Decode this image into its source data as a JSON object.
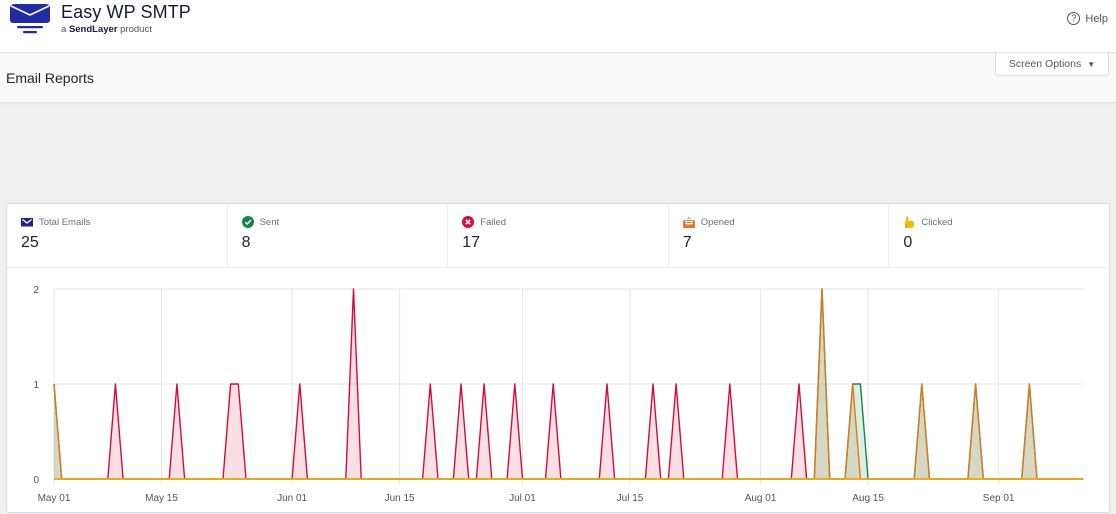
{
  "header": {
    "brand_title": "Easy WP SMTP",
    "brand_sub_prefix": "a ",
    "brand_sub_name": "SendLayer",
    "brand_sub_suffix": " product",
    "help_label": "Help",
    "logo_icon": "envelope-logo-icon",
    "help_icon": "question-circle-icon"
  },
  "subheader": {
    "page_title": "Email Reports",
    "screen_options_label": "Screen Options",
    "screen_options_icon": "caret-down-icon"
  },
  "stats": [
    {
      "key": "total",
      "label": "Total Emails",
      "value": "25",
      "icon": "envelope-icon",
      "color": "#1f1f8e"
    },
    {
      "key": "sent",
      "label": "Sent",
      "value": "8",
      "icon": "check-circle-icon",
      "color": "#128549"
    },
    {
      "key": "failed",
      "label": "Failed",
      "value": "17",
      "icon": "x-circle-icon",
      "color": "#d63638"
    },
    {
      "key": "opened",
      "label": "Opened",
      "value": "7",
      "icon": "open-envelope-icon",
      "color": "#e27730"
    },
    {
      "key": "clicked",
      "label": "Clicked",
      "value": "0",
      "icon": "pointing-hand-icon",
      "color": "#f5b90a"
    }
  ],
  "chart_data": {
    "type": "area",
    "title": "",
    "xlabel": "",
    "ylabel": "",
    "x_start": "May 01",
    "x_end": "Sep 12",
    "x_days": 134,
    "x_ticks": [
      {
        "label": "May 01",
        "day": 0
      },
      {
        "label": "May 15",
        "day": 14
      },
      {
        "label": "Jun 01",
        "day": 31
      },
      {
        "label": "Jun 15",
        "day": 45
      },
      {
        "label": "Jul 01",
        "day": 61
      },
      {
        "label": "Jul 15",
        "day": 75
      },
      {
        "label": "Aug 01",
        "day": 92
      },
      {
        "label": "Aug 15",
        "day": 106
      },
      {
        "label": "Sep 01",
        "day": 123
      }
    ],
    "y_ticks": [
      0,
      1,
      2
    ],
    "ylim": [
      0,
      2
    ],
    "grid": true,
    "legend": "none",
    "series": [
      {
        "name": "Failed",
        "color": "#d60a3c",
        "fill": "rgba(230,80,110,0.18)",
        "points": [
          [
            8,
            1
          ],
          [
            16,
            1
          ],
          [
            23,
            1
          ],
          [
            24,
            1
          ],
          [
            32,
            1
          ],
          [
            39,
            2
          ],
          [
            49,
            1
          ],
          [
            53,
            1
          ],
          [
            56,
            1
          ],
          [
            60,
            1
          ],
          [
            65,
            1
          ],
          [
            72,
            1
          ],
          [
            78,
            1
          ],
          [
            81,
            1
          ],
          [
            88,
            1
          ],
          [
            97,
            1
          ]
        ]
      },
      {
        "name": "Sent",
        "color": "#128549",
        "fill": "rgba(18,133,73,0.15)",
        "points": [
          [
            0,
            1
          ],
          [
            100,
            2
          ],
          [
            104,
            1
          ],
          [
            105,
            1
          ],
          [
            113,
            1
          ],
          [
            120,
            1
          ],
          [
            127,
            1
          ]
        ]
      },
      {
        "name": "Opened",
        "color": "#d97a1e",
        "fill": "rgba(200,140,80,0.22)",
        "points": [
          [
            0,
            1
          ],
          [
            100,
            2
          ],
          [
            104,
            1
          ],
          [
            113,
            1
          ],
          [
            120,
            1
          ],
          [
            127,
            1
          ]
        ]
      },
      {
        "name": "Clicked",
        "color": "#f0b90b",
        "fill": "rgba(240,185,11,0.1)",
        "points": []
      }
    ]
  }
}
